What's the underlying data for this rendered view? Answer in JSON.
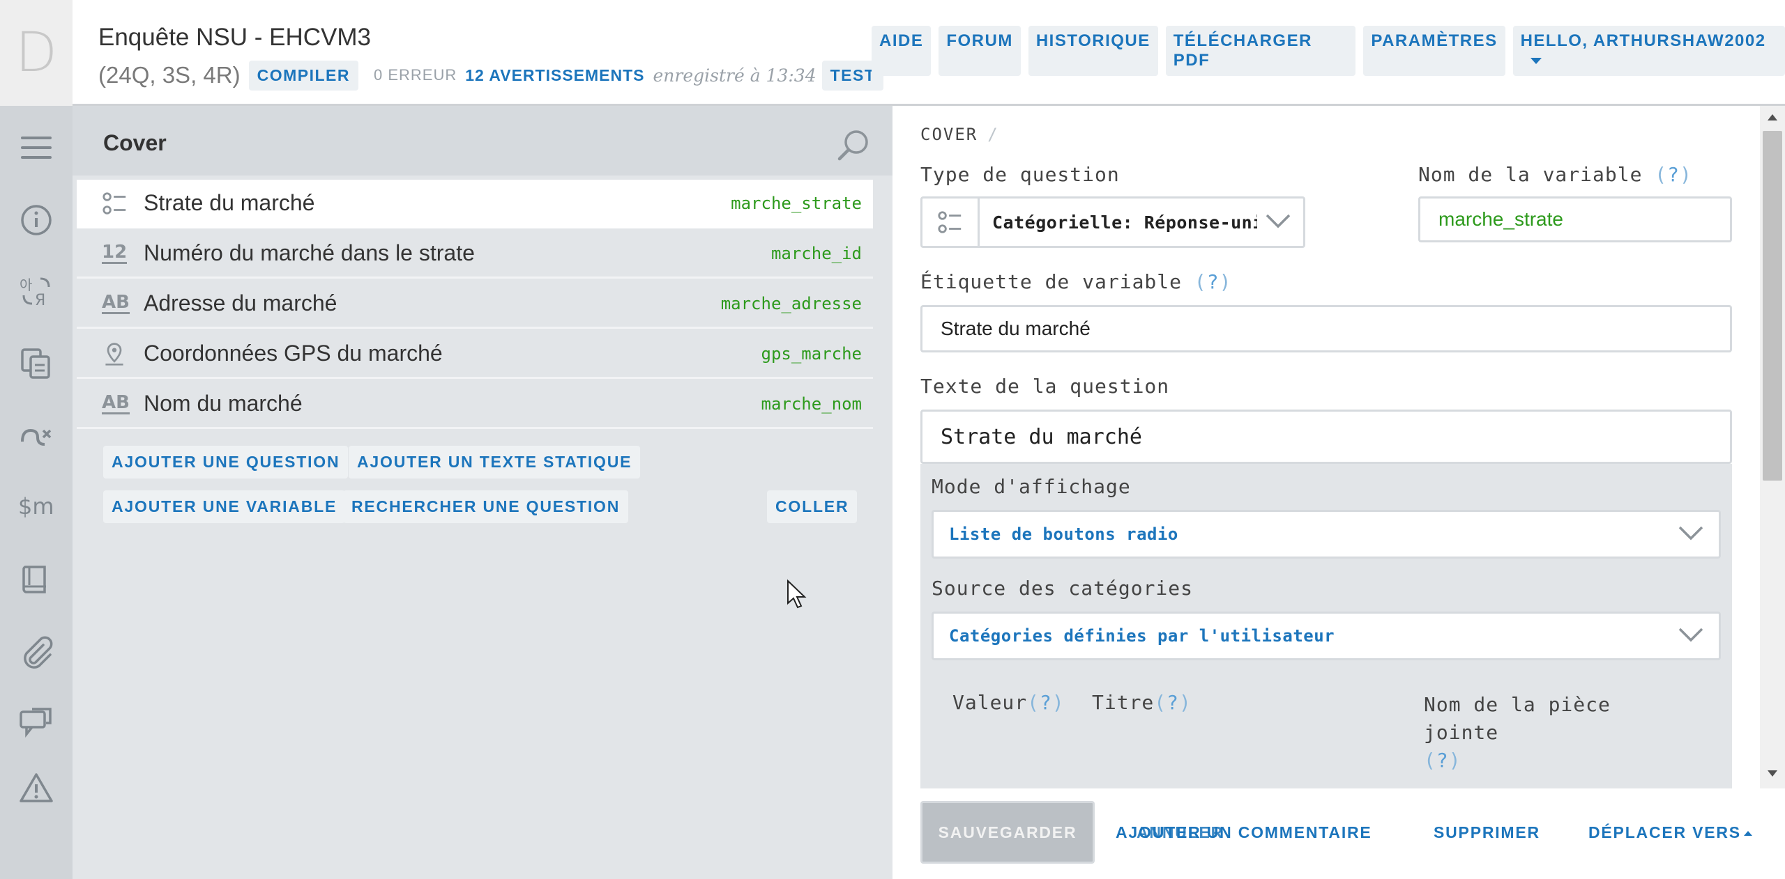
{
  "header": {
    "logo_letter": "D",
    "title": "Enquête NSU - EHCVM3",
    "counts": "(24Q, 3S, 4R)",
    "compile_label": "COMPILER",
    "errors_label": "0 ERREUR",
    "warnings_label": "12 AVERTISSEMENTS",
    "saved_label": "enregistré à 13:34",
    "test_label": "TEST",
    "nav": {
      "help": "AIDE",
      "forum": "FORUM",
      "history": "HISTORIQUE",
      "download_pdf": "TÉLÉCHARGER PDF",
      "settings": "PARAMÈTRES",
      "user": "HELLO, ARTHURSHAW2002"
    }
  },
  "rail": {
    "icons": [
      "menu-icon",
      "info-icon",
      "translation-icon",
      "copy-icon",
      "macros-icon",
      "lookup-tables-icon",
      "book-icon",
      "attachment-icon",
      "comments-icon",
      "warning-icon"
    ]
  },
  "chapter": {
    "title": "Cover",
    "questions": [
      {
        "icon": "single-choice-icon",
        "text": "Strate du marché",
        "variable": "marche_strate",
        "active": true
      },
      {
        "icon": "numeric-icon",
        "icon_text": "12",
        "text": "Numéro du marché dans le strate",
        "variable": "marche_id"
      },
      {
        "icon": "text-icon",
        "icon_text": "AB",
        "text": "Adresse du marché",
        "variable": "marche_adresse"
      },
      {
        "icon": "gps-icon",
        "text": "Coordonnées GPS du marché",
        "variable": "gps_marche"
      },
      {
        "icon": "text-icon",
        "icon_text": "AB",
        "text": "Nom du marché",
        "variable": "marche_nom"
      }
    ],
    "buttons": {
      "add_question": "AJOUTER UNE QUESTION",
      "add_static_text": "AJOUTER UN TEXTE STATIQUE",
      "add_variable": "AJOUTER UNE VARIABLE",
      "search_question": "RECHERCHER UNE QUESTION",
      "paste": "COLLER"
    }
  },
  "editor": {
    "breadcrumb": "COVER",
    "breadcrumb_sep": "/",
    "question_type_label": "Type de question",
    "question_type_value": "Catégorielle: Réponse-unique",
    "variable_name_label": "Nom de la variable",
    "variable_name_value": "marche_strate",
    "variable_label_label": "Étiquette de variable",
    "variable_label_value": "Strate du marché",
    "question_text_label": "Texte de la question",
    "question_text_value": "Strate du marché",
    "display_mode_label": "Mode d'affichage",
    "display_mode_value": "Liste de boutons radio",
    "category_source_label": "Source des catégories",
    "category_source_value": "Catégories définies par l'utilisateur",
    "col_value": "Valeur",
    "col_title": "Titre",
    "col_attachment": "Nom de la pièce jointe",
    "help_mark": "?"
  },
  "actions": {
    "save": "SAUVEGARDER",
    "add_comment": "AJOUTER UN COMMENTAIRE",
    "cancel_overlay": "ANNULER",
    "delete": "SUPPRIMER",
    "move_to": "DÉPLACER VERS"
  },
  "colors": {
    "accent": "#1c75bc",
    "variable_green": "#2d9a1c",
    "rail_bg": "#d0d4d8",
    "panel_bg": "#e2e5e8"
  }
}
